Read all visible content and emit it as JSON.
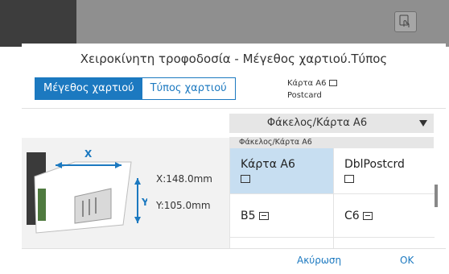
{
  "header": {
    "icon": "touch-panel-icon"
  },
  "dialog": {
    "title": "Χειροκίνητη τροφοδοσία - Μέγεθος χαρτιού.Τύπος",
    "tabs": [
      {
        "label": "Μέγεθος χαρτιού",
        "active": true
      },
      {
        "label": "Τύπος χαρτιού",
        "active": false
      }
    ],
    "current": {
      "size": "Κάρτα A6",
      "type": "Postcard"
    },
    "dropdown": {
      "selected": "Φάκελος/Κάρτα A6"
    },
    "illustration": {
      "x_label": "X",
      "y_label": "Y"
    },
    "dimensions": {
      "x": "X:148.0mm",
      "y": "Y:105.0mm"
    },
    "grid": {
      "header": "Φάκελος/Κάρτα A6",
      "items": [
        {
          "label": "Κάρτα A6",
          "selected": true
        },
        {
          "label": "DblPostcrd",
          "selected": false
        },
        {
          "label": "B5",
          "selected": false
        },
        {
          "label": "C6",
          "selected": false
        }
      ]
    },
    "buttons": {
      "cancel": "Ακύρωση",
      "ok": "OK"
    }
  },
  "colors": {
    "accent": "#1c79c0",
    "selected_cell": "#c7def1",
    "header_bar": "#8f8f8f"
  }
}
